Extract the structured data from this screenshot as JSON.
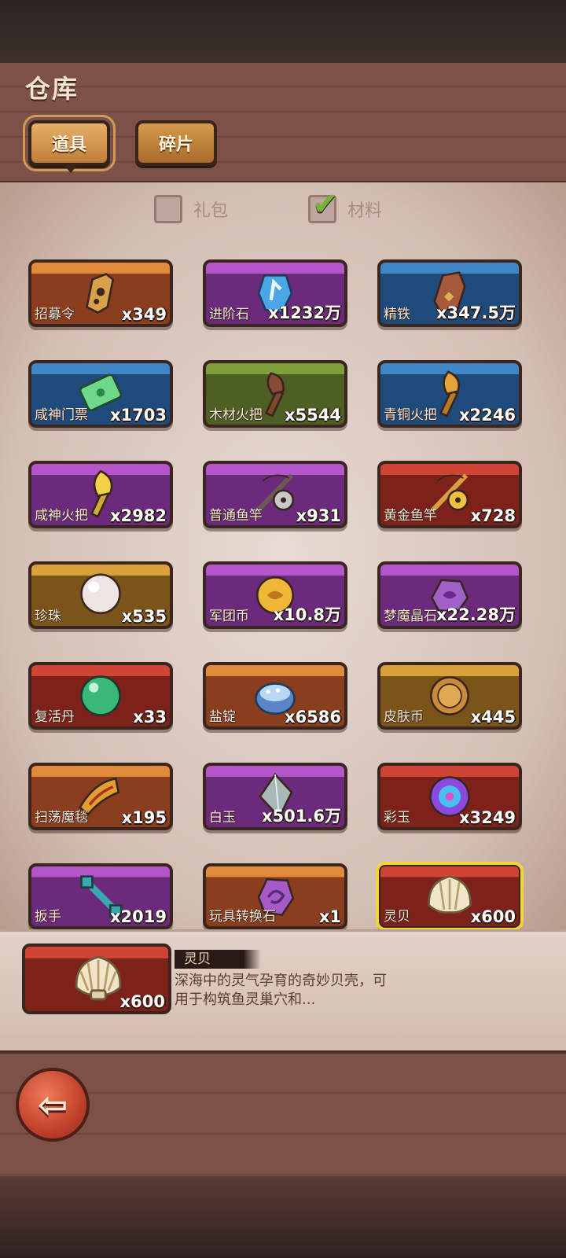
{
  "header": {
    "title": "仓库"
  },
  "tabs": [
    {
      "label": "道具",
      "active": true
    },
    {
      "label": "碎片",
      "active": false
    }
  ],
  "filters": [
    {
      "label": "礼包",
      "checked": false
    },
    {
      "label": "材料",
      "checked": true
    }
  ],
  "items": [
    {
      "name": "招募令",
      "qty": "x349",
      "rarity": "orange",
      "icon": "coffin-token-icon"
    },
    {
      "name": "进阶石",
      "qty": "x1232万",
      "rarity": "purple",
      "icon": "rune-stone-icon"
    },
    {
      "name": "精铁",
      "qty": "x347.5万",
      "rarity": "blue",
      "icon": "iron-ore-icon"
    },
    {
      "name": "咸神门票",
      "qty": "x1703",
      "rarity": "blue",
      "icon": "ticket-icon"
    },
    {
      "name": "木材火把",
      "qty": "x5544",
      "rarity": "green",
      "icon": "wood-torch-icon"
    },
    {
      "name": "青铜火把",
      "qty": "x2246",
      "rarity": "blue",
      "icon": "bronze-torch-icon"
    },
    {
      "name": "咸神火把",
      "qty": "x2982",
      "rarity": "purple",
      "icon": "golden-torch-icon"
    },
    {
      "name": "普通鱼竿",
      "qty": "x931",
      "rarity": "purple",
      "icon": "fishing-rod-icon"
    },
    {
      "name": "黄金鱼竿",
      "qty": "x728",
      "rarity": "red",
      "icon": "golden-rod-icon"
    },
    {
      "name": "珍珠",
      "qty": "x535",
      "rarity": "gold",
      "icon": "pearl-icon"
    },
    {
      "name": "军团币",
      "qty": "x10.8万",
      "rarity": "purple",
      "icon": "legion-coin-icon"
    },
    {
      "name": "梦魔晶石",
      "qty": "x22.28万",
      "rarity": "purple",
      "icon": "crystal-icon"
    },
    {
      "name": "复活丹",
      "qty": "x33",
      "rarity": "red",
      "icon": "revive-pill-icon"
    },
    {
      "name": "盐锭",
      "qty": "x6586",
      "rarity": "orange",
      "icon": "salt-bowl-icon"
    },
    {
      "name": "皮肤币",
      "qty": "x445",
      "rarity": "gold",
      "icon": "skin-coin-icon"
    },
    {
      "name": "扫荡魔毯",
      "qty": "x195",
      "rarity": "orange",
      "icon": "magic-carpet-icon"
    },
    {
      "name": "白玉",
      "qty": "x501.6万",
      "rarity": "purple",
      "icon": "white-jade-icon"
    },
    {
      "name": "彩玉",
      "qty": "x3249",
      "rarity": "red",
      "icon": "rainbow-jade-icon"
    },
    {
      "name": "扳手",
      "qty": "x2019",
      "rarity": "purple",
      "icon": "wrench-icon"
    },
    {
      "name": "玩具转换石",
      "qty": "x1",
      "rarity": "orange",
      "icon": "toy-stone-icon"
    },
    {
      "name": "灵贝",
      "qty": "x600",
      "rarity": "red",
      "icon": "shell-icon",
      "selected": true
    }
  ],
  "detail": {
    "name": "灵贝",
    "qty": "x600",
    "description": "深海中的灵气孕育的奇妙贝壳，可用于构筑鱼灵巢穴和..."
  },
  "colors": {
    "selected_outline": "#f5d33a",
    "check_green": "#79b23a",
    "back_button": "#c2412a"
  }
}
